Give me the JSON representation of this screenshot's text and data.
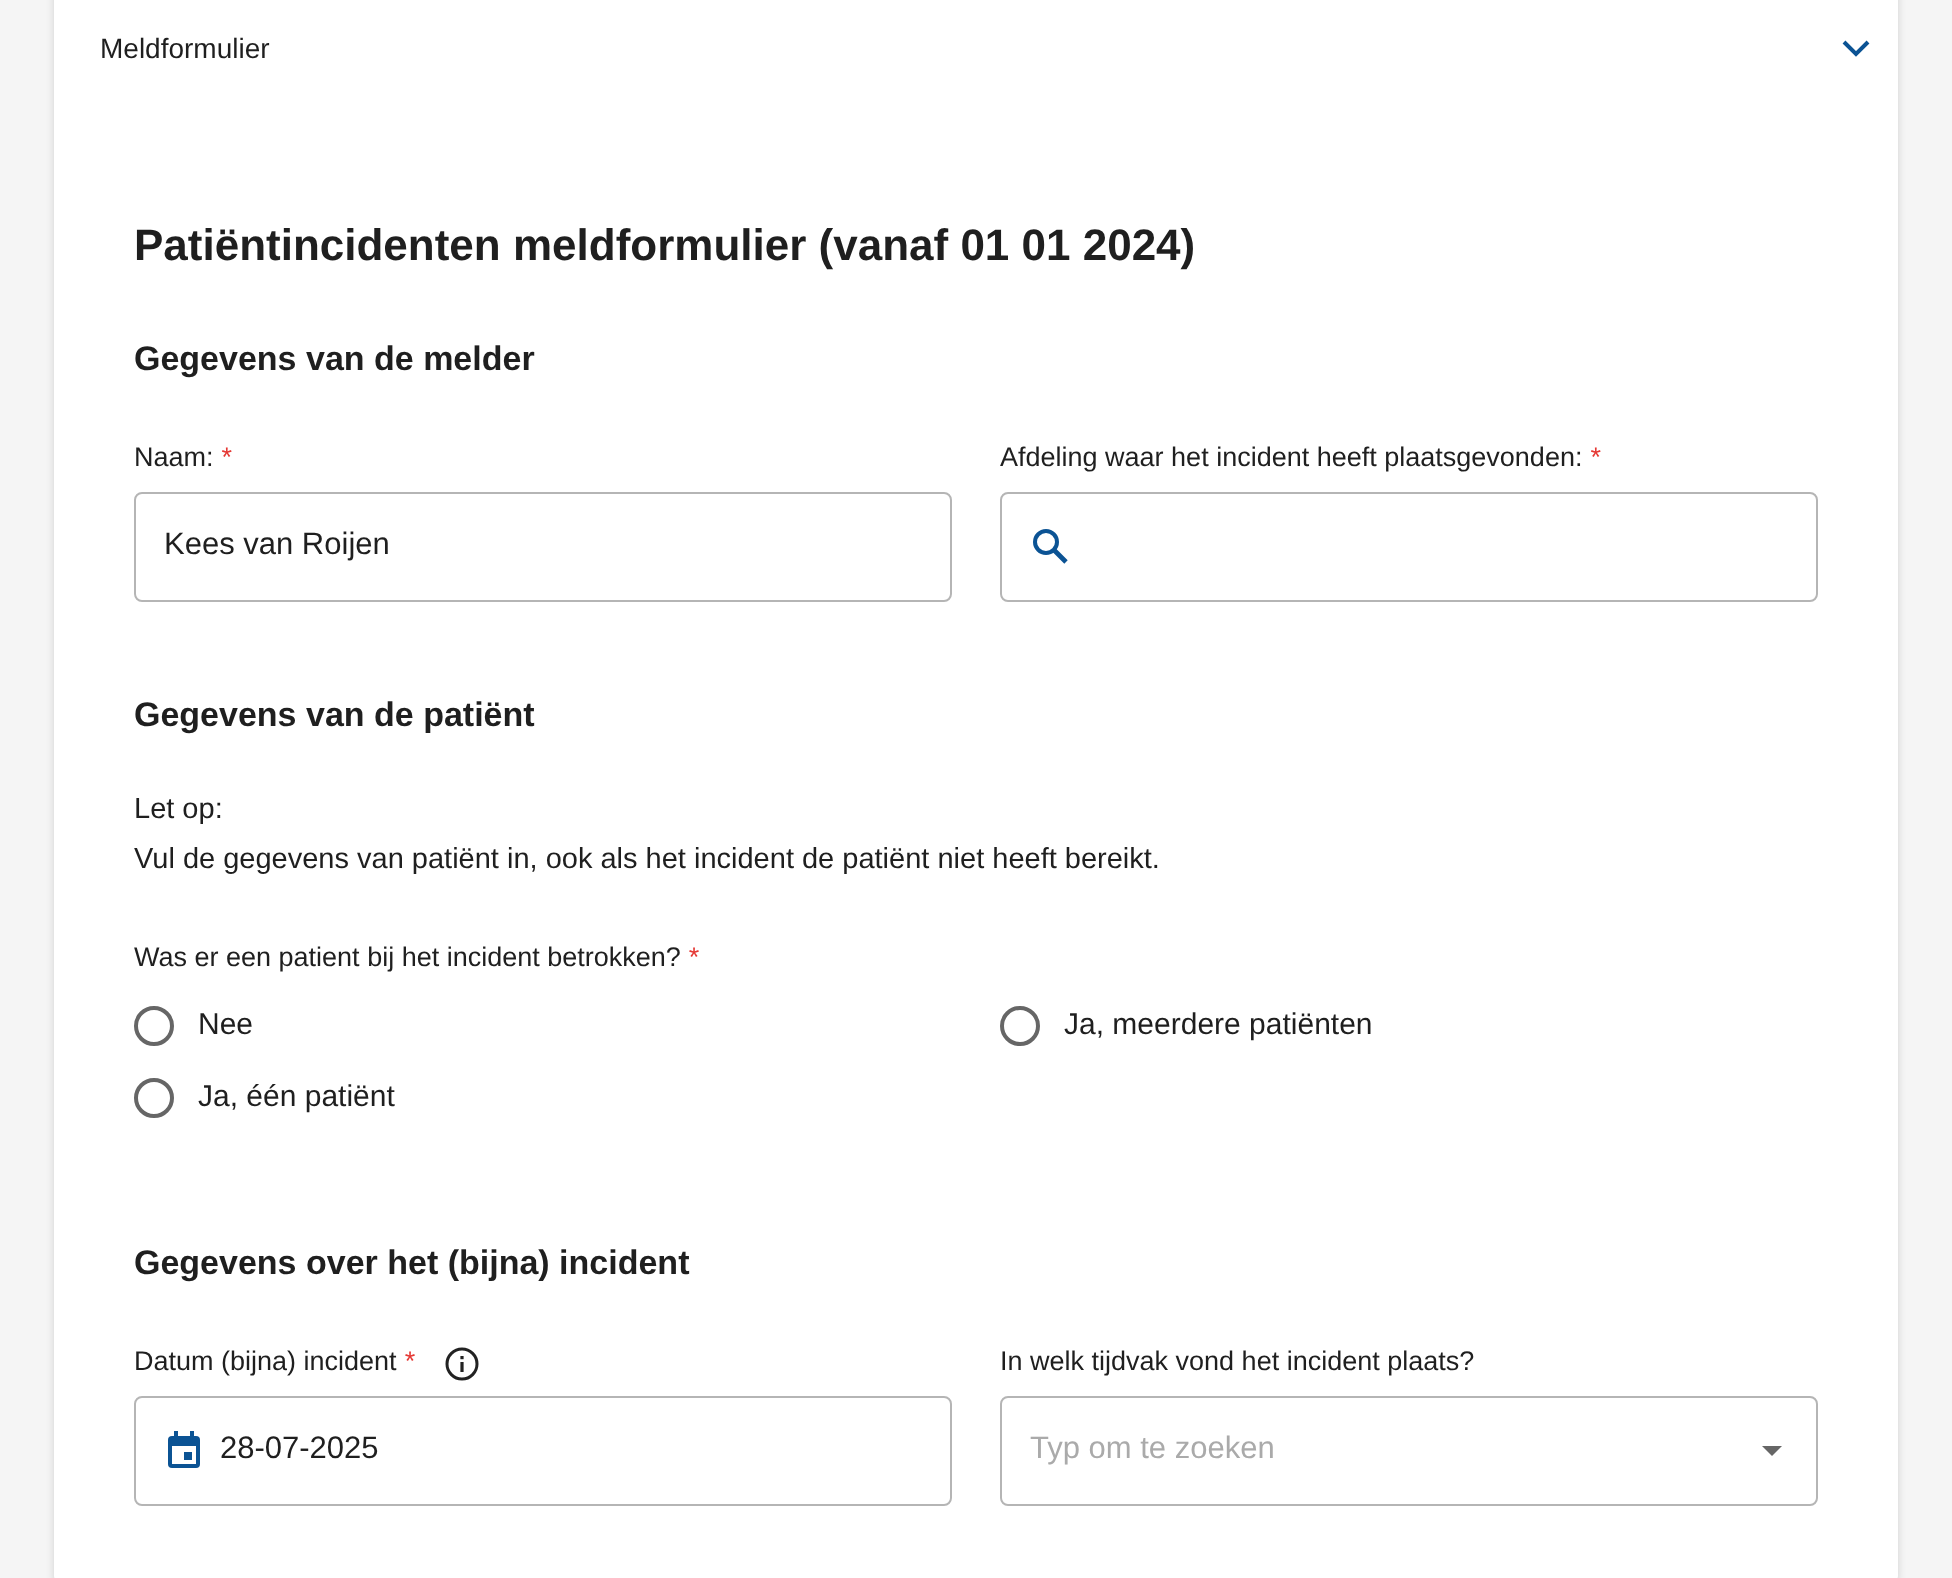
{
  "panel": {
    "title": "Meldformulier",
    "expanded": true
  },
  "form": {
    "title": "Patiëntincidenten meldformulier (vanaf 01 01 2024)",
    "sections": [
      {
        "heading": "Gegevens van de melder",
        "fields": [
          {
            "kind": "text",
            "label": "Naam:",
            "marker": "*",
            "value": "Kees van Roijen"
          },
          {
            "kind": "search",
            "label": "Afdeling waar het incident heeft plaatsgevonden:",
            "marker": "*"
          }
        ]
      },
      {
        "heading": "Gegevens van de patiënt",
        "note": [
          "Let op:",
          "Vul de gegevens van patiënt in, ook als het incident de patiënt niet heeft bereikt."
        ],
        "question": {
          "label": "Was er een patient bij het incident betrokken?",
          "marker": "*",
          "options": [
            {
              "label": "Nee",
              "selected": false
            },
            {
              "label": "Ja, meerdere patiënten",
              "selected": false
            },
            {
              "label": "Ja, één patiënt",
              "selected": false
            }
          ]
        }
      },
      {
        "heading": "Gegevens over het (bijna) incident",
        "fields": [
          {
            "kind": "date",
            "label": "Datum (bijna) incident",
            "marker": "*",
            "info": true,
            "value": "28-07-2025"
          },
          {
            "kind": "select",
            "label": "In welk tijdvak vond het incident plaats?",
            "placeholder": "Typ om te zoeken"
          }
        ]
      }
    ]
  }
}
